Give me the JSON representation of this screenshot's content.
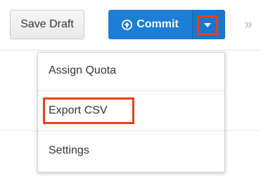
{
  "toolbar": {
    "save_draft_label": "Save Draft",
    "commit_label": "Commit",
    "more_symbol": "»"
  },
  "dropdown": {
    "items": [
      {
        "label": "Assign Quota"
      },
      {
        "label": "Export CSV"
      },
      {
        "label": "Settings"
      }
    ]
  },
  "colors": {
    "commit_blue": "#1d7ed8",
    "highlight_red": "#e8401c"
  },
  "icons": {
    "commit": "arrow-circle-up-icon",
    "caret": "chevron-down-icon",
    "more": "double-chevron-right-icon"
  }
}
